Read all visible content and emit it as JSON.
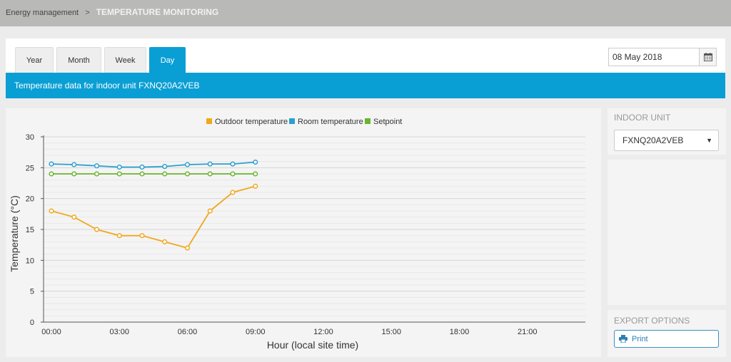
{
  "breadcrumb": {
    "parent": "Energy management",
    "separator": ">",
    "current": "TEMPERATURE MONITORING"
  },
  "tabs": [
    {
      "label": "Year"
    },
    {
      "label": "Month"
    },
    {
      "label": "Week"
    },
    {
      "label": "Day",
      "active": true
    }
  ],
  "date": {
    "value": "08 May 2018"
  },
  "header": {
    "title": "Temperature data for indoor unit FXNQ20A2VEB"
  },
  "sidebar": {
    "indoor_unit_title": "INDOOR UNIT",
    "indoor_unit_selected": "FXNQ20A2VEB",
    "export_title": "EXPORT OPTIONS",
    "print_label": "Print"
  },
  "icons": {
    "calendar": "calendar-icon",
    "print": "printer-icon",
    "dropdown": "chevron-down-icon"
  },
  "colors": {
    "accent": "#0a9fd4",
    "outdoor": "#f0a81c",
    "room": "#2a9fd0",
    "setpoint": "#6ab42e"
  },
  "chart_data": {
    "type": "line",
    "title": "",
    "xlabel": "Hour (local site time)",
    "ylabel": "Temperature (°C)",
    "x_ticks": [
      "00:00",
      "03:00",
      "06:00",
      "09:00",
      "12:00",
      "15:00",
      "18:00",
      "21:00"
    ],
    "y_ticks": [
      0,
      5,
      10,
      15,
      20,
      25,
      30
    ],
    "ylim": [
      0,
      30
    ],
    "xlim_hours": [
      0,
      24
    ],
    "legend_position": "top-center",
    "grid": true,
    "series": [
      {
        "name": "Outdoor temperature",
        "color": "#f0a81c",
        "x": [
          0,
          1,
          2,
          3,
          4,
          5,
          6,
          7,
          8,
          9
        ],
        "values": [
          18,
          17,
          15,
          14,
          14,
          13,
          12,
          18,
          21,
          22
        ]
      },
      {
        "name": "Room temperature",
        "color": "#2a9fd0",
        "x": [
          0,
          1,
          2,
          3,
          4,
          5,
          6,
          7,
          8,
          9
        ],
        "values": [
          25.6,
          25.5,
          25.3,
          25.1,
          25.1,
          25.2,
          25.5,
          25.6,
          25.6,
          25.9
        ]
      },
      {
        "name": "Setpoint",
        "color": "#6ab42e",
        "x": [
          0,
          1,
          2,
          3,
          4,
          5,
          6,
          7,
          8,
          9
        ],
        "values": [
          24,
          24,
          24,
          24,
          24,
          24,
          24,
          24,
          24,
          24
        ]
      }
    ]
  }
}
